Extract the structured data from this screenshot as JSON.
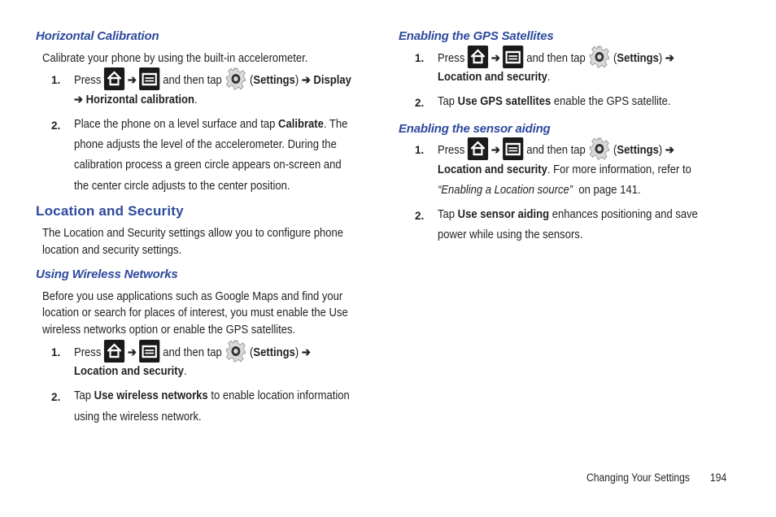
{
  "left": {
    "horizontal_calibration": {
      "heading": "Horizontal Calibration",
      "intro": "Calibrate your phone by using the built-in accelerometer.",
      "step1": {
        "num": "1.",
        "press": "Press",
        "arrow": "➔",
        "then_tap": "and then tap",
        "settings": "Settings",
        "display": "Display",
        "horizontal_calibration": "Horizontal calibration"
      },
      "step2": {
        "num": "2.",
        "line1_pre": "Place the phone on a level surface and tap",
        "calibrate": "Calibrate",
        "line1_post": ". The",
        "line2": "phone adjusts the level of the accelerometer. During the",
        "line3": "calibration process a green circle appears on-screen and",
        "line4": "the center circle adjusts to the center position."
      }
    },
    "location_security": {
      "heading": "Location and Security",
      "line1": "The Location and Security settings allow you to configure phone",
      "line2": "location and security settings."
    },
    "wireless_networks": {
      "heading": "Using Wireless Networks",
      "line1": "Before you use applications such as Google Maps and find your",
      "line2": "location or search for places of interest, you must enable the Use",
      "line3": "wireless networks option or enable the GPS satellites.",
      "step1": {
        "num": "1.",
        "press": "Press",
        "arrow": "➔",
        "then_tap": "and then tap",
        "settings": "Settings",
        "location_security": "Location and security"
      },
      "step2": {
        "num": "2.",
        "tap": "Tap",
        "bold": "Use wireless networks",
        "post": "to enable location information",
        "line2": "using the wireless network."
      }
    }
  },
  "right": {
    "gps": {
      "heading": "Enabling the GPS Satellites",
      "step1": {
        "num": "1.",
        "press": "Press",
        "arrow": "➔",
        "then_tap": "and then tap",
        "settings": "Settings",
        "location_security": "Location and security"
      },
      "step2": {
        "num": "2.",
        "tap": "Tap",
        "bold": "Use GPS satellites",
        "post": "enable the GPS satellite."
      }
    },
    "sensor": {
      "heading": "Enabling the sensor aiding",
      "step1": {
        "num": "1.",
        "press": "Press",
        "arrow": "➔",
        "then_tap": "and then tap",
        "settings": "Settings",
        "location_security": "Location and security",
        "refer": ". For more information, refer to",
        "link": "“Enabling a Location source”",
        "page_ref": "on page 141."
      },
      "step2": {
        "num": "2.",
        "tap": "Tap",
        "bold": "Use sensor aiding",
        "post": "enhances positioning and save",
        "line2": "power while using the sensors."
      }
    }
  },
  "footer": {
    "section": "Changing Your Settings",
    "page": "194"
  },
  "icons": {
    "home": "home-key-icon",
    "menu": "menu-key-icon",
    "settings": "settings-gear-icon"
  }
}
